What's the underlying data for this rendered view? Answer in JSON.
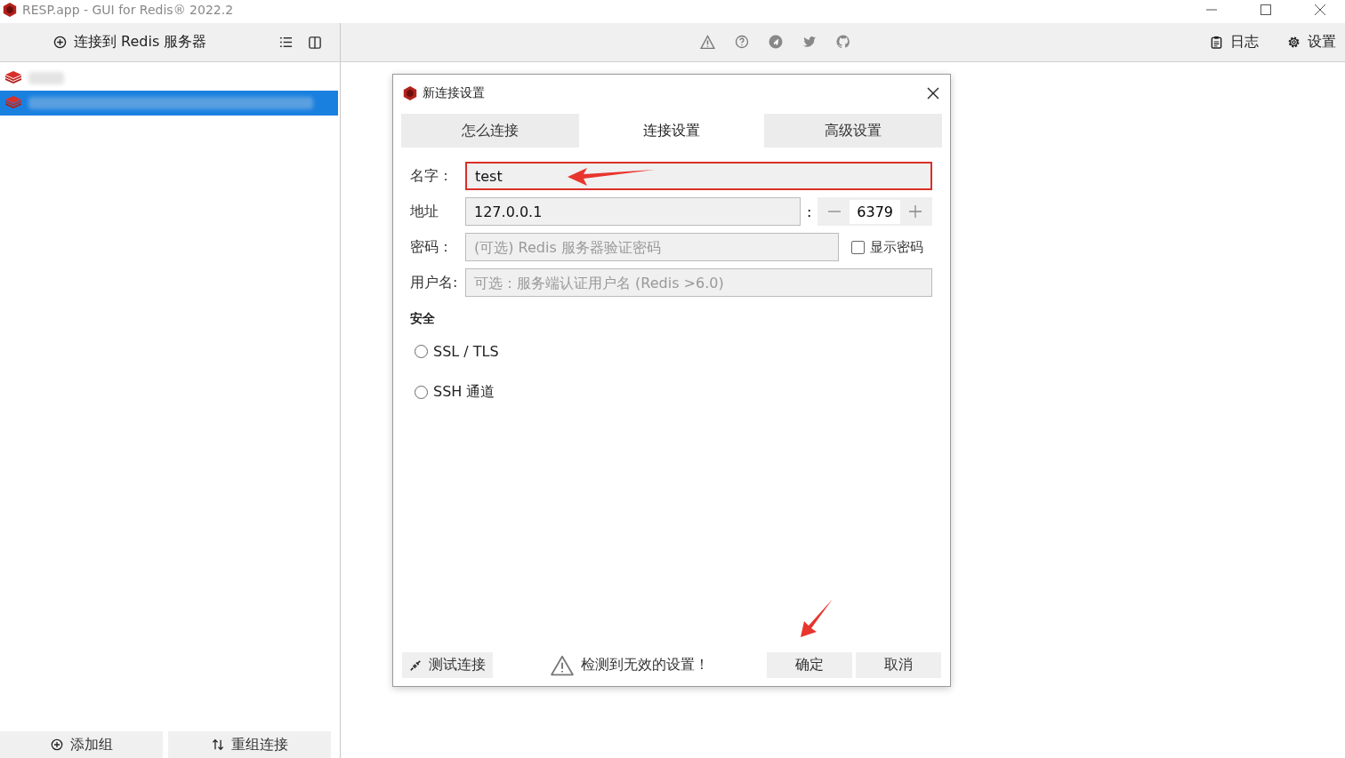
{
  "window": {
    "title": "RESP.app - GUI for Redis® 2022.2"
  },
  "toolbar": {
    "connect_button": "连接到 Redis 服务器",
    "log_button": "日志",
    "settings_button": "设置"
  },
  "connections": [
    {
      "selected": false
    },
    {
      "selected": true
    }
  ],
  "sidebar_footer": {
    "add_group": "添加组",
    "reorder": "重组连接"
  },
  "dialog": {
    "title": "新连接设置",
    "tabs": [
      {
        "label": "怎么连接",
        "selected": false
      },
      {
        "label": "连接设置",
        "selected": true
      },
      {
        "label": "高级设置",
        "selected": false
      }
    ],
    "fields": {
      "name_label": "名字：",
      "name_value": "test",
      "name_invalid": true,
      "address_label": "地址",
      "address_value": "127.0.0.1",
      "port_separator": ":",
      "port_value": "6379",
      "password_label": "密码：",
      "password_placeholder": "(可选) Redis 服务器验证密码",
      "show_password": {
        "label": "显示密码",
        "checked": false
      },
      "username_label": "用户名:",
      "username_placeholder": "可选：服务端认证用户名 (Redis >6.0)"
    },
    "security": {
      "heading": "安全",
      "options": [
        {
          "label": "SSL / TLS",
          "selected": false
        },
        {
          "label": "SSH 通道",
          "selected": false
        }
      ]
    },
    "test_button": "测试连接",
    "warning": "检测到无效的设置！",
    "ok_button": "确定",
    "cancel_button": "取消"
  }
}
